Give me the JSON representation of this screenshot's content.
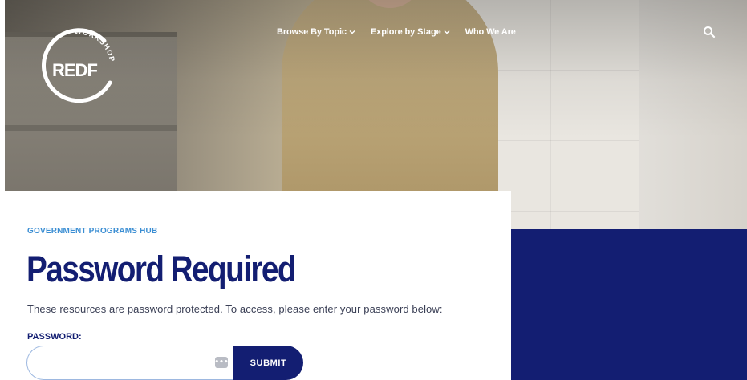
{
  "header": {
    "logo": {
      "wordmark": "REDF",
      "arc_text": "WORKSHOP"
    },
    "nav": [
      {
        "label": "Browse By Topic",
        "has_dropdown": true,
        "icon": "chevron-down-icon"
      },
      {
        "label": "Explore by Stage",
        "has_dropdown": true,
        "icon": "chevron-down-icon"
      },
      {
        "label": "Who We Are",
        "has_dropdown": false
      }
    ],
    "search_icon": "search-icon"
  },
  "main": {
    "eyebrow": "GOVERNMENT PROGRAMS HUB",
    "title": "Password Required",
    "description": "These resources are password protected. To access, please enter your password below:",
    "form": {
      "password_label": "PASSWORD:",
      "password_value": "",
      "password_placeholder": "",
      "password_manager_icon": "ellipsis-key-icon",
      "submit_label": "SUBMIT"
    }
  },
  "colors": {
    "brand_navy": "#131e72",
    "eyebrow_blue": "#3b8ed3",
    "body_text": "#3a3f55",
    "input_border": "#9db8e0"
  }
}
